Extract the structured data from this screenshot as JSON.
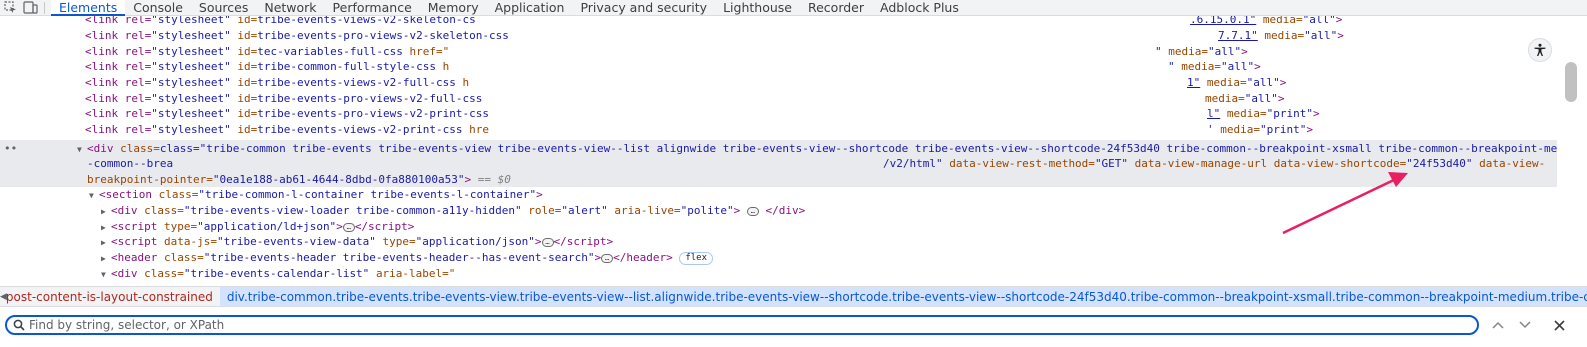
{
  "toolbar": {
    "tabs": [
      "Elements",
      "Console",
      "Sources",
      "Network",
      "Performance",
      "Memory",
      "Application",
      "Privacy and security",
      "Lighthouse",
      "Recorder",
      "Adblock Plus"
    ],
    "active_tab": "Elements"
  },
  "code": {
    "links": [
      {
        "id": "tribe-events-views-v2-skeleton-cs",
        "tail": ".6.15.0.1\"",
        "media": "\"all\""
      },
      {
        "id": "tribe-events-pro-views-v2-skeleton-css",
        "tail": "7.7.1\"",
        "media": "\"all\""
      },
      {
        "id": "tec-variables-full-css",
        "href_prefix": "href=\"",
        "tail": "\"",
        "media": "\"all\""
      },
      {
        "id": "tribe-common-full-style-css",
        "href_prefix": "h",
        "tail": "\"",
        "media": "\"all\""
      },
      {
        "id": "tribe-events-views-v2-full-css",
        "href_prefix": "h",
        "tail": "1\"",
        "media": "\"all\""
      },
      {
        "id": "tribe-events-pro-views-v2-full-css",
        "tail": "",
        "media": "\"all\""
      },
      {
        "id": "tribe-events-pro-views-v2-print-css",
        "tail": "l\"",
        "media": "\"print\""
      },
      {
        "id": "tribe-events-views-v2-print-css",
        "href_prefix": "hre",
        "tail": "'",
        "media": "\"print\""
      }
    ],
    "link_open": "<link rel=",
    "link_rel_value": "\"stylesheet\"",
    "id_attr": " id=",
    "media_attr": " media=",
    "close": ">",
    "div_line1": "class=\"tribe-common tribe-events tribe-events-view tribe-events-view--list alignwide tribe-events-view--shortcode tribe-events-view--shortcode-24f53d40 tribe-common--breakpoint-xsmall tribe-common--breakpoint-medium tribe",
    "div_line2_start": "-common--brea",
    "div_line2_mid": "/v2/html\"",
    "div_line2_rest_attr1": " data-view-rest-method=",
    "div_line2_rest_val1": "\"GET\"",
    "div_line2_rest_attr2": " data-view-manage-url data-view-shortcode=",
    "div_line2_rest_val2": "\"24f53d40\"",
    "div_line2_rest_attr3": " data-view-",
    "div_line3_attr": "breakpoint-pointer=",
    "div_line3_val": "\"0ea1e188-ab61-4644-8dbd-0fa880100a53\"",
    "div_line3_marker": " == $0",
    "section_class": "\"tribe-common-l-container tribe-events-l-container\"",
    "loader_class": "\"tribe-events-view-loader tribe-common-a11y-hidden\"",
    "loader_role": "\"alert\"",
    "loader_live": "\"polite\"",
    "script1_type": "\"application/ld+json\"",
    "script2_js": "\"tribe-events-view-data\"",
    "script2_type": "\"application/json\"",
    "header_class": "\"tribe-events-header tribe-events-header--has-event-search\"",
    "header_badge": "flex",
    "list_div_class": "\"tribe-events-calendar-list\"",
    "list_div_aria": "aria-label=\"",
    "dots": "••",
    "ellipsis": "…"
  },
  "breadcrumbs": [
    "post-content-is-layout-constrained",
    "div.tribe-common.tribe-events.tribe-events-view.tribe-events-view--list.alignwide.tribe-events-view--shortcode.tribe-events-view--shortcode-24f53d40.tribe-common--breakpoint-xsmall.tribe-common--breakpoint-medium.tribe-common--breakpoint-full"
  ],
  "search": {
    "placeholder": "Find by string, selector, or XPath",
    "value": ""
  },
  "colors": {
    "accent": "#0b57d0",
    "annotation_arrow": "#e91e63"
  },
  "icons": {
    "inspect": "inspect-element-icon",
    "device": "device-toolbar-icon",
    "a11y": "accessibility-icon",
    "search": "search-icon",
    "up": "chevron-up-icon",
    "down": "chevron-down-icon",
    "close": "close-icon"
  }
}
